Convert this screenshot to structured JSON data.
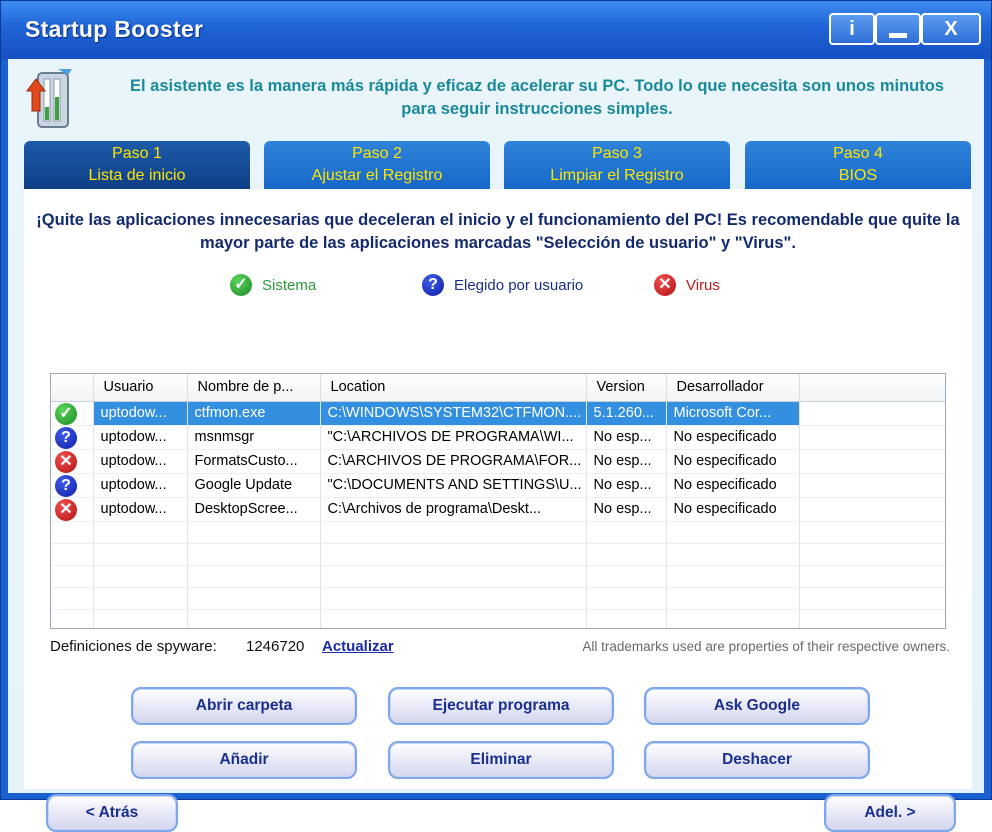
{
  "window": {
    "title": "Startup Booster",
    "info_label": "i",
    "close_label": "X"
  },
  "header": {
    "description": "El asistente es la manera más rápida y eficaz de acelerar su PC. Todo lo que necesita son unos minutos para seguir instrucciones simples."
  },
  "tabs": [
    {
      "step": "Paso 1",
      "name": "Lista de inicio",
      "active": true
    },
    {
      "step": "Paso 2",
      "name": "Ajustar el Registro",
      "active": false
    },
    {
      "step": "Paso 3",
      "name": "Limpiar el Registro",
      "active": false
    },
    {
      "step": "Paso 4",
      "name": "BIOS",
      "active": false
    }
  ],
  "instructions": "¡Quite las aplicaciones innecesarias que deceleran el inicio y el funcionamiento del PC! Es recomendable que quite la mayor parte de las aplicaciones marcadas \"Selección de usuario\" y \"Virus\".",
  "legend": {
    "system": "Sistema",
    "user": "Elegido por usuario",
    "virus": "Virus"
  },
  "table": {
    "columns": [
      "Usuario",
      "Nombre de p...",
      "Location",
      "Version",
      "Desarrollador"
    ],
    "rows": [
      {
        "status": "system",
        "icon": "check-icon",
        "user": "uptodow...",
        "name": "ctfmon.exe",
        "location": "C:\\WINDOWS\\SYSTEM32\\CTFMON....",
        "version": "5.1.260...",
        "developer": "Microsoft Cor...",
        "selected": true
      },
      {
        "status": "user",
        "icon": "question-icon",
        "user": "uptodow...",
        "name": "msnmsgr",
        "location": "\"C:\\ARCHIVOS DE PROGRAMA\\WI...",
        "version": "No esp...",
        "developer": "No especificado",
        "selected": false
      },
      {
        "status": "virus",
        "icon": "cross-icon",
        "user": "uptodow...",
        "name": "FormatsCusto...",
        "location": "C:\\ARCHIVOS DE PROGRAMA\\FOR...",
        "version": "No esp...",
        "developer": "No especificado",
        "selected": false
      },
      {
        "status": "user",
        "icon": "question-icon",
        "user": "uptodow...",
        "name": "Google Update",
        "location": "\"C:\\DOCUMENTS AND SETTINGS\\U...",
        "version": "No esp...",
        "developer": "No especificado",
        "selected": false
      },
      {
        "status": "virus",
        "icon": "cross-icon",
        "user": "uptodow...",
        "name": "DesktopScree...",
        "location": "C:\\Archivos de programa\\Deskt...",
        "version": "No esp...",
        "developer": "No especificado",
        "selected": false
      }
    ]
  },
  "spyware": {
    "label": "Definiciones de spyware:",
    "count": "1246720",
    "update_link": "Actualizar"
  },
  "trademark": "All trademarks used are properties of their respective owners.",
  "buttons": {
    "open_folder": "Abrir carpeta",
    "run_program": "Ejecutar programa",
    "ask_google": "Ask Google",
    "add": "Añadir",
    "delete": "Eliminar",
    "undo": "Deshacer",
    "back": "< Atrás",
    "next": "Adel. >"
  },
  "colors": {
    "title_bar": "#1f63d6",
    "tab_text": "#ffe600",
    "header_text": "#1a8a9a",
    "selection": "#3390e0",
    "system_green": "#2a9a3a",
    "user_blue": "#1a2f8a",
    "virus_red": "#c01818"
  }
}
